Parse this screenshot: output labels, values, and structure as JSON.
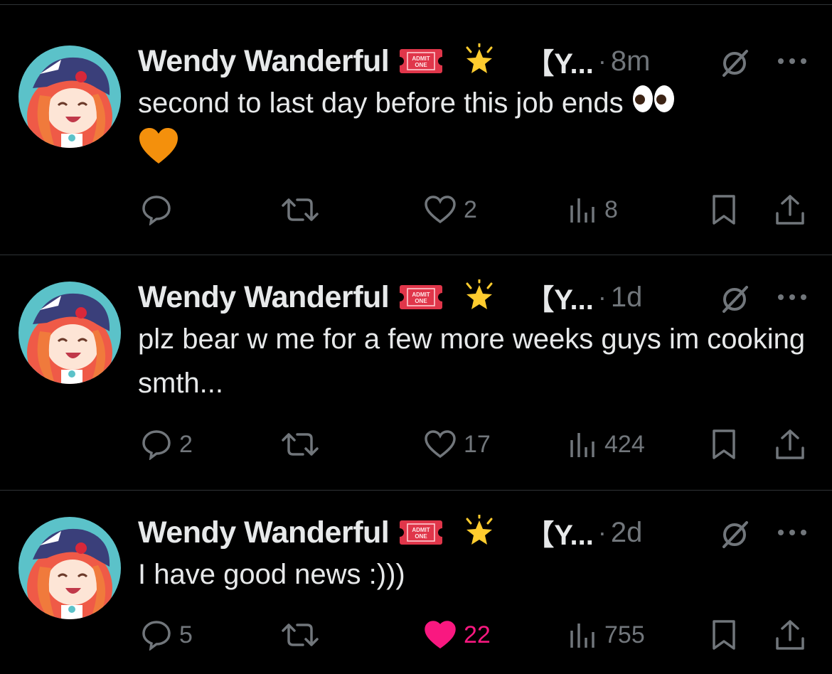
{
  "tweets": [
    {
      "name": "Wendy Wanderful",
      "handle": "【Y...",
      "dot": "·",
      "time": "8m",
      "text": "second to last day before this job ends",
      "emojis": [
        "eyes-emoji",
        "orange-heart-emoji"
      ],
      "replies": "",
      "likes": "2",
      "liked": false,
      "views": "8"
    },
    {
      "name": "Wendy Wanderful",
      "handle": "【Y...",
      "dot": "·",
      "time": "1d",
      "text": "plz bear w me for a few more weeks guys im cooking smth...",
      "emojis": [],
      "replies": "2",
      "likes": "17",
      "liked": false,
      "views": "424"
    },
    {
      "name": "Wendy Wanderful",
      "handle": "【Y...",
      "dot": "·",
      "time": "2d",
      "text": "I have good news :)))",
      "emojis": [],
      "replies": "5",
      "likes": "22",
      "liked": true,
      "views": "755"
    }
  ],
  "colors": {
    "background": "#000000",
    "text": "#e7e9ea",
    "muted": "#71767b",
    "like_active": "#f91880",
    "divider": "#2f3336"
  },
  "icons": [
    "admit-one-ticket-icon",
    "glowing-star-icon",
    "grok-icon",
    "more-icon",
    "reply-icon",
    "retweet-icon",
    "like-icon",
    "views-icon",
    "bookmark-icon",
    "share-icon"
  ]
}
